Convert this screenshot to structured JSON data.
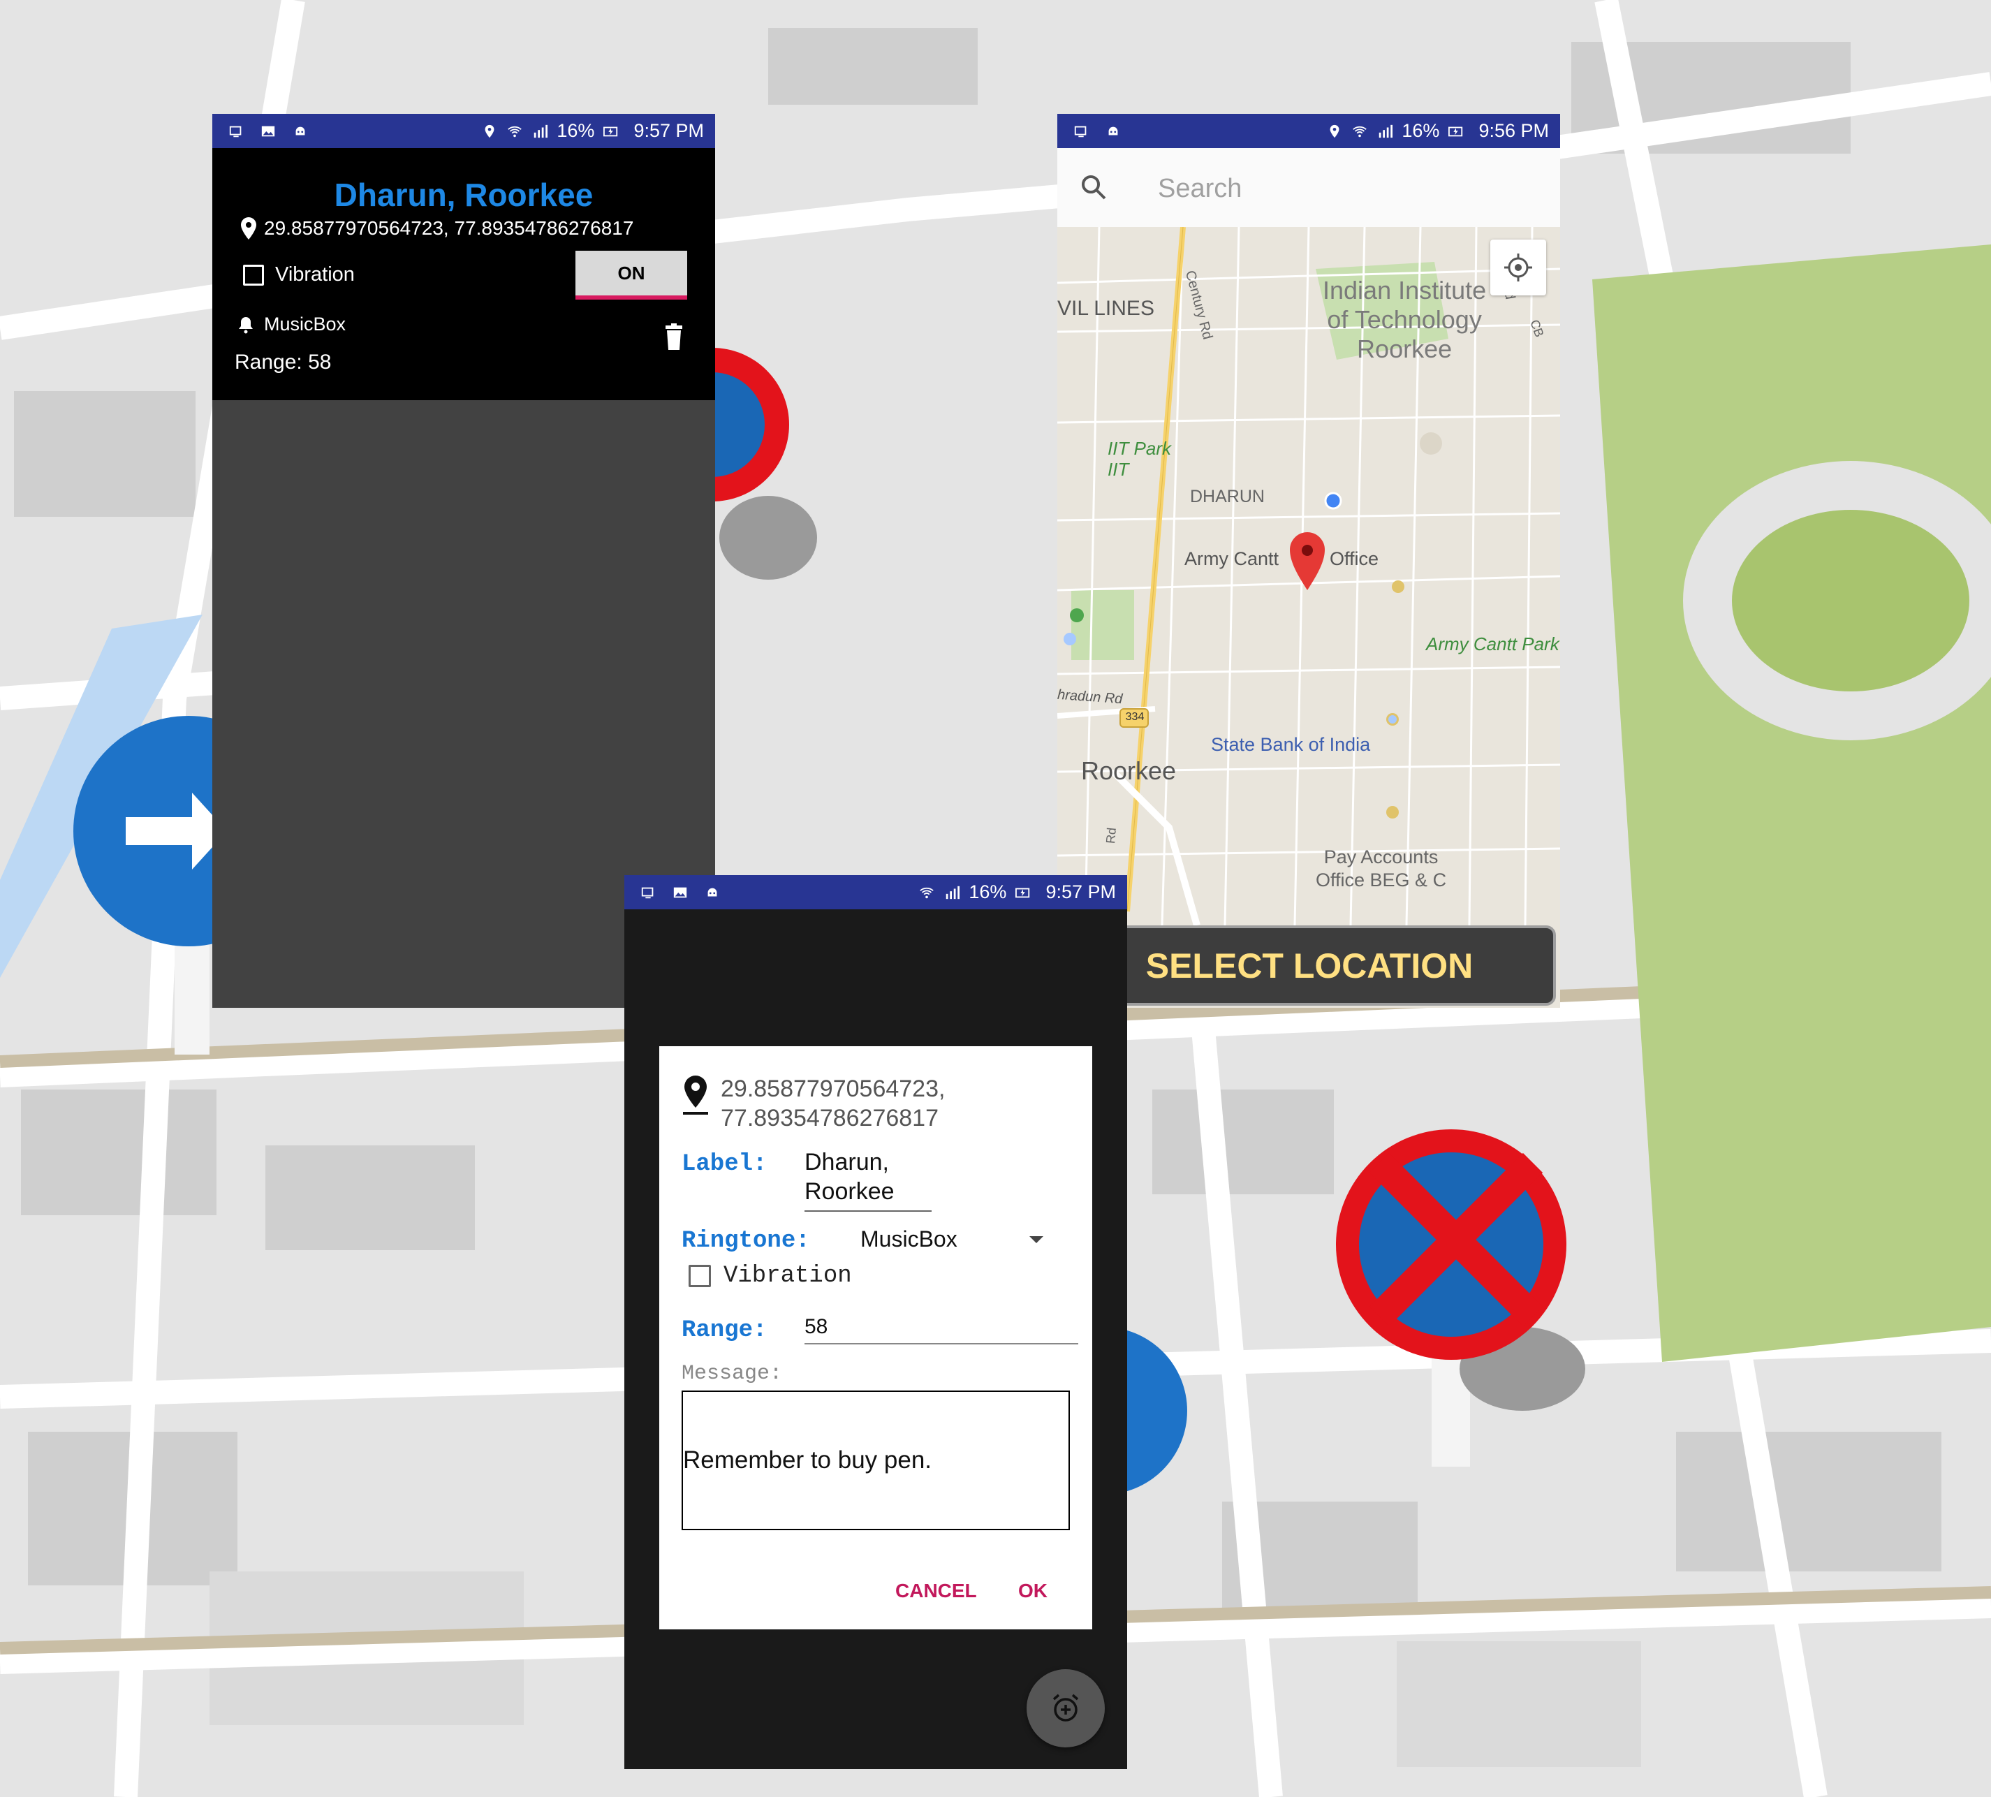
{
  "status_bar_left": {
    "time": "9:57 PM",
    "battery": "16%"
  },
  "status_bar_map": {
    "time": "9:56 PM",
    "battery": "16%"
  },
  "status_bar_dialog": {
    "time": "9:57 PM",
    "battery": "16%"
  },
  "reminder_card": {
    "title": "Dharun, Roorkee",
    "coordinates": "29.85877970564723, 77.89354786276817",
    "vibration_label": "Vibration",
    "vibration_checked": false,
    "toggle_label": "ON",
    "ringtone": "MusicBox",
    "range": "Range: 58"
  },
  "map_screen": {
    "search_placeholder": "Search",
    "select_button": "SELECT LOCATION",
    "labels": {
      "iit": [
        "Indian Institute",
        "of Technology",
        "Roorkee"
      ],
      "civil_lines": "VIL LINES",
      "century_rd": "Century Rd",
      "iit_park": [
        "IIT Park",
        "IIT"
      ],
      "dharun": "DHARUN",
      "army_cantt": "Army Cantt",
      "office": "Office",
      "army_cantt_park": "Army Cantt Park",
      "dehradun_rd": "hradun Rd",
      "route": "334",
      "sbi": "State Bank of India",
      "roorkee": "Roorkee",
      "pay_accounts": [
        "Pay Accounts",
        "Office BEG & C"
      ],
      "rd": "Rd",
      "h_rd": "h Rd",
      "cb": "CB"
    },
    "colors": {
      "map_bg": "#e9e5dc",
      "road_yellow": "#f6d26b",
      "park_green": "#c8dfb0",
      "marker_red": "#e53935",
      "location_blue": "#4285f4"
    }
  },
  "dialog": {
    "coords_line1": "29.85877970564723,",
    "coords_line2": "77.89354786276817",
    "label_key": "Label:",
    "label_line1": "Dharun,",
    "label_line2": "Roorkee",
    "ringtone_key": "Ringtone:",
    "ringtone_value": "MusicBox",
    "vibration_label": "Vibration",
    "vibration_checked": false,
    "range_key": "Range:",
    "range_value": "58",
    "message_key": "Message:",
    "message_value": "Remember to buy pen.",
    "cancel": "CANCEL",
    "ok": "OK"
  },
  "icons": {
    "fab": "add-alarm-icon",
    "trash": "delete-icon",
    "bell": "bell-icon",
    "pin": "location-pin-icon"
  },
  "colors": {
    "status_bar": "#283593",
    "title_blue": "#1e88e5",
    "accent_pink": "#c2185b",
    "select_text": "#ffe082"
  }
}
